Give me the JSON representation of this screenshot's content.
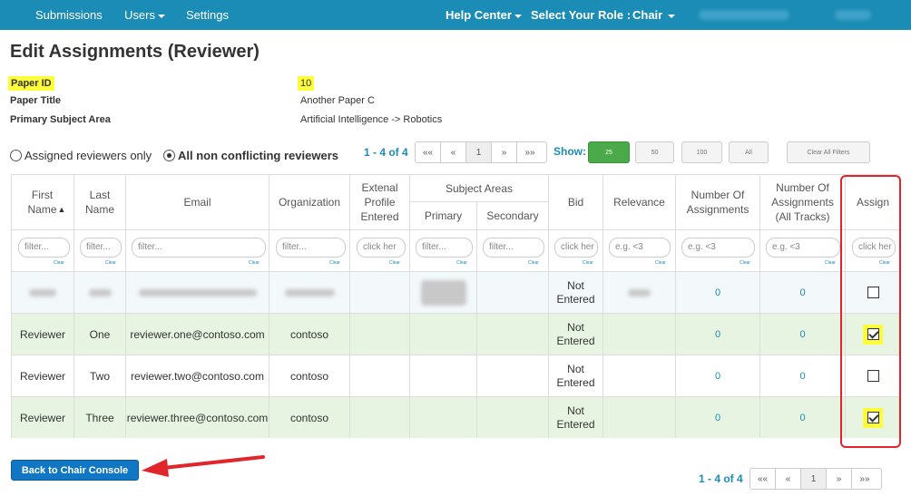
{
  "nav": {
    "submissions": "Submissions",
    "users": "Users",
    "settings": "Settings",
    "help_center": "Help Center",
    "role_label": "Select Your Role :",
    "role": "Chair"
  },
  "page": {
    "title": "Edit Assignments (Reviewer)"
  },
  "info": {
    "paper_id_label": "Paper ID",
    "paper_id": "10",
    "paper_title_label": "Paper Title",
    "paper_title": "Another Paper C",
    "subject_label": "Primary Subject Area",
    "subject": "Artificial Intelligence -> Robotics"
  },
  "filters": {
    "assigned_only": "Assigned reviewers only",
    "all_non_conflicting": "All non conflicting reviewers",
    "count": "1 - 4 of 4",
    "show_label": "Show:",
    "sizes": [
      "25",
      "50",
      "100",
      "All"
    ],
    "clear_all": "Clear All Filters"
  },
  "pager": {
    "first": "««",
    "prev": "«",
    "page": "1",
    "next": "»",
    "last": "»»"
  },
  "table": {
    "headers": {
      "first_name": "First Name",
      "last_name": "Last Name",
      "email": "Email",
      "organization": "Organization",
      "external_profile": "Extenal Profile Entered",
      "subject_areas": "Subject Areas",
      "primary": "Primary",
      "secondary": "Secondary",
      "bid": "Bid",
      "relevance": "Relevance",
      "num_assignments": "Number Of Assignments",
      "num_assignments_all": "Number Of Assignments (All Tracks)",
      "assign": "Assign"
    },
    "filter_placeholders": {
      "text": "filter...",
      "click": "click her",
      "lt": "e.g. <3"
    },
    "clear": "Clear",
    "rows": [
      {
        "first": "",
        "last": "",
        "email": "",
        "org": "",
        "bid": "Not Entered",
        "num": "0",
        "num_all": "0",
        "assigned": false
      },
      {
        "first": "Reviewer",
        "last": "One",
        "email": "reviewer.one@contoso.com",
        "org": "contoso",
        "bid": "Not Entered",
        "num": "0",
        "num_all": "0",
        "assigned": true
      },
      {
        "first": "Reviewer",
        "last": "Two",
        "email": "reviewer.two@contoso.com",
        "org": "contoso",
        "bid": "Not Entered",
        "num": "0",
        "num_all": "0",
        "assigned": false
      },
      {
        "first": "Reviewer",
        "last": "Three",
        "email": "reviewer.three@contoso.com",
        "org": "contoso",
        "bid": "Not Entered",
        "num": "0",
        "num_all": "0",
        "assigned": true
      }
    ]
  },
  "footer": {
    "back_button": "Back to Chair Console",
    "count": "1 - 4 of 4"
  },
  "colors": {
    "nav": "#1b8cb5",
    "accent": "#1b8cb5",
    "highlight": "#fdfd3a",
    "row_green": "#e7f4e1",
    "annotation_red": "#e0262b"
  }
}
